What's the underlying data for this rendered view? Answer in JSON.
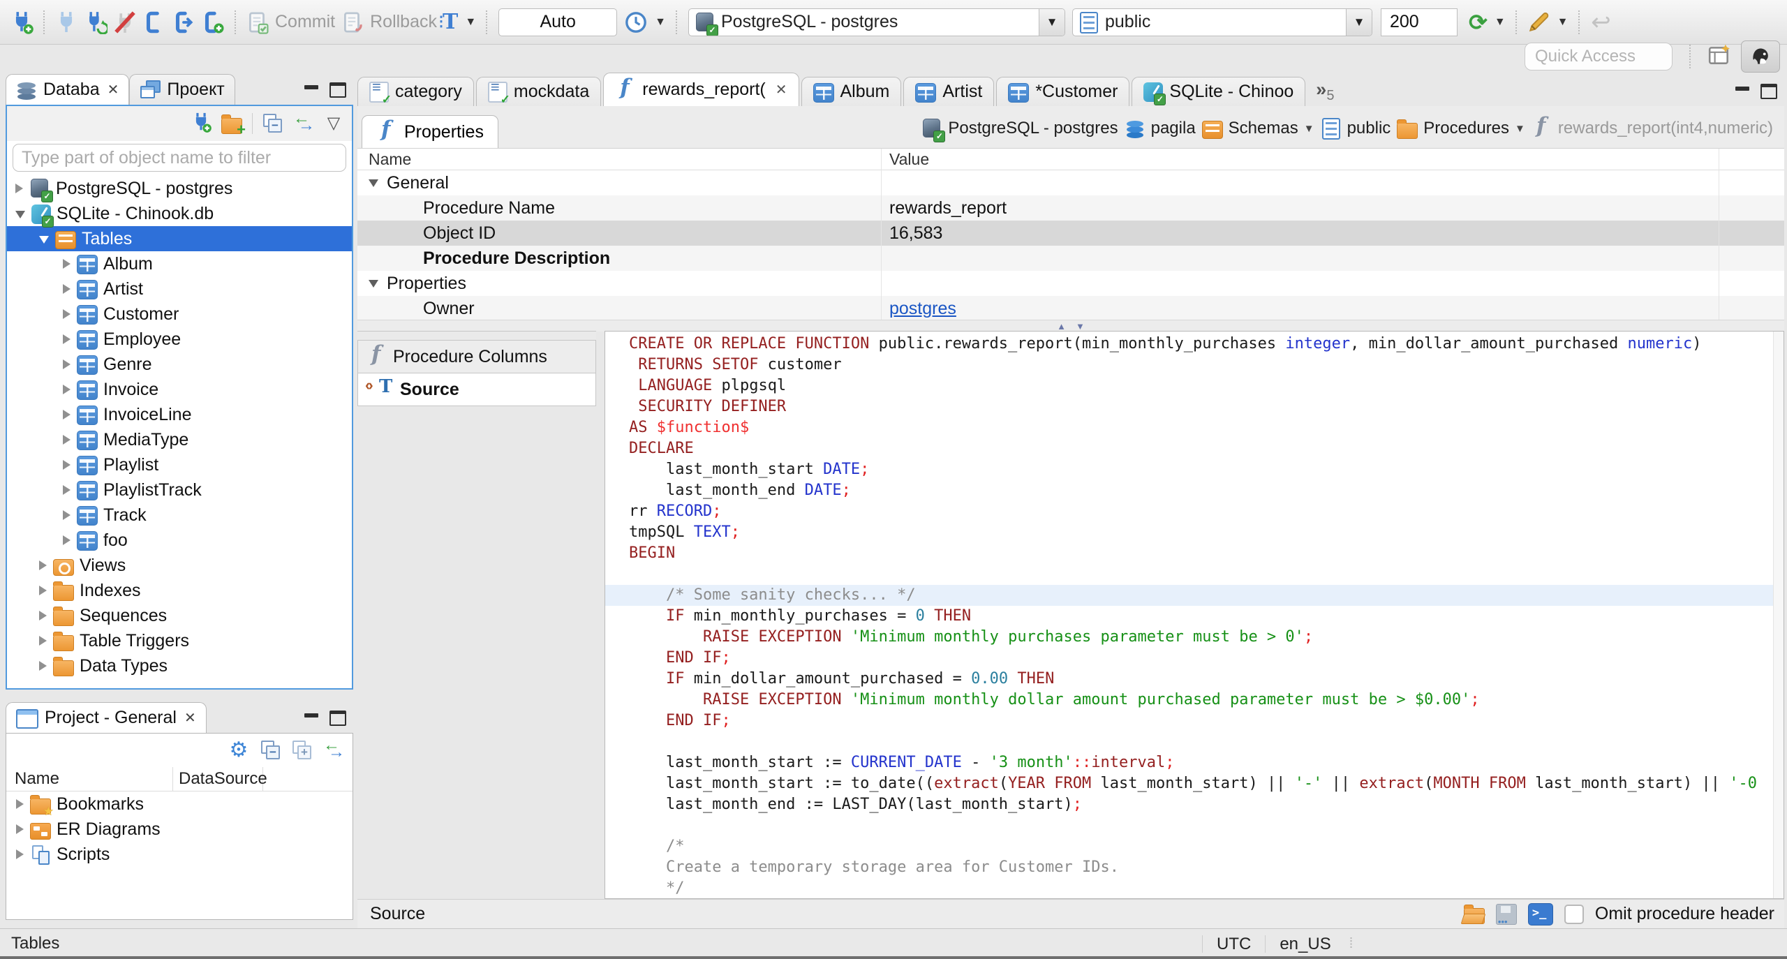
{
  "colors": {
    "selection_blue": "#2e70d9",
    "focus_border_blue": "#519ade",
    "link_blue": "#1a56c4",
    "syntax_keyword": "#941f1f",
    "syntax_type": "#2333cc",
    "syntax_string": "#169016",
    "syntax_number": "#2a7f9e",
    "syntax_punct": "#e02020",
    "syntax_comment": "#8c8c8c",
    "current_line": "#e7f0fb",
    "folder_orange": "#ec9733",
    "table_blue": "#4384cc"
  },
  "toolbar": {
    "commit": "Commit",
    "rollback": "Rollback",
    "auto_commit": "Auto",
    "connection": "PostgreSQL - postgres",
    "schema": "public",
    "fetch_size": "200",
    "quick_access_placeholder": "Quick Access"
  },
  "nav": {
    "tab_database": "Databa",
    "tab_project": "Проект",
    "filter_placeholder": "Type part of object name to filter",
    "tree": [
      {
        "ind": 0,
        "exp": "c",
        "icon": "pg",
        "label": "PostgreSQL - postgres"
      },
      {
        "ind": 0,
        "exp": "o",
        "icon": "sqlite",
        "label": "SQLite - Chinook.db"
      },
      {
        "ind": 1,
        "exp": "o",
        "icon": "tables",
        "label": "Tables",
        "sel": true
      },
      {
        "ind": 2,
        "exp": "c",
        "icon": "table",
        "label": "Album"
      },
      {
        "ind": 2,
        "exp": "c",
        "icon": "table",
        "label": "Artist"
      },
      {
        "ind": 2,
        "exp": "c",
        "icon": "table",
        "label": "Customer"
      },
      {
        "ind": 2,
        "exp": "c",
        "icon": "table",
        "label": "Employee"
      },
      {
        "ind": 2,
        "exp": "c",
        "icon": "table",
        "label": "Genre"
      },
      {
        "ind": 2,
        "exp": "c",
        "icon": "table",
        "label": "Invoice"
      },
      {
        "ind": 2,
        "exp": "c",
        "icon": "table",
        "label": "InvoiceLine"
      },
      {
        "ind": 2,
        "exp": "c",
        "icon": "table",
        "label": "MediaType"
      },
      {
        "ind": 2,
        "exp": "c",
        "icon": "table",
        "label": "Playlist"
      },
      {
        "ind": 2,
        "exp": "c",
        "icon": "table",
        "label": "PlaylistTrack"
      },
      {
        "ind": 2,
        "exp": "c",
        "icon": "table",
        "label": "Track"
      },
      {
        "ind": 2,
        "exp": "c",
        "icon": "table",
        "label": "foo"
      },
      {
        "ind": 1,
        "exp": "c",
        "icon": "views",
        "label": "Views"
      },
      {
        "ind": 1,
        "exp": "c",
        "icon": "folder",
        "label": "Indexes"
      },
      {
        "ind": 1,
        "exp": "c",
        "icon": "folder",
        "label": "Sequences"
      },
      {
        "ind": 1,
        "exp": "c",
        "icon": "folder",
        "label": "Table Triggers"
      },
      {
        "ind": 1,
        "exp": "c",
        "icon": "folder",
        "label": "Data Types"
      }
    ]
  },
  "project": {
    "tab": "Project - General",
    "col_name": "Name",
    "col_datasource": "DataSource",
    "tree": [
      {
        "icon": "bookmarks",
        "label": "Bookmarks"
      },
      {
        "icon": "er",
        "label": "ER Diagrams"
      },
      {
        "icon": "scripts",
        "label": "Scripts"
      }
    ]
  },
  "editor": {
    "tabs": [
      {
        "icon": "sql",
        "label": "category"
      },
      {
        "icon": "sql",
        "label": "mockdata"
      },
      {
        "icon": "func",
        "label": "rewards_report(",
        "active": true,
        "close": true
      },
      {
        "icon": "table",
        "label": "Album"
      },
      {
        "icon": "table",
        "label": "Artist"
      },
      {
        "icon": "table",
        "label": "*Customer"
      },
      {
        "icon": "sqlite",
        "label": "SQLite - Chinoo"
      }
    ],
    "overflow_count": "5"
  },
  "properties_view": {
    "tab": "Properties",
    "breadcrumb": [
      {
        "icon": "pg",
        "label": "PostgreSQL - postgres"
      },
      {
        "icon": "dbblue",
        "label": "pagila"
      },
      {
        "icon": "tables",
        "label": "Schemas",
        "dd": true
      },
      {
        "icon": "schema",
        "label": "public"
      },
      {
        "icon": "folder",
        "label": "Procedures",
        "dd": true
      },
      {
        "icon": "func",
        "label": "rewards_report(int4,numeric)",
        "muted": true
      }
    ],
    "grid": {
      "col_name": "Name",
      "col_value": "Value",
      "rows": [
        {
          "kind": "category",
          "name": "General"
        },
        {
          "kind": "item",
          "name": "Procedure Name",
          "value": "rewards_report",
          "shade": true
        },
        {
          "kind": "item",
          "name": "Object ID",
          "value": "16,583",
          "selected": true
        },
        {
          "kind": "item",
          "name": "Procedure Description",
          "value": "",
          "bold": true,
          "shade": true
        },
        {
          "kind": "category",
          "name": "Properties"
        },
        {
          "kind": "item",
          "name": "Owner",
          "value": "postgres",
          "link": true,
          "shade": true
        }
      ]
    }
  },
  "subtabs": [
    {
      "label": "Procedure Columns",
      "icon": "func"
    },
    {
      "label": "Source",
      "icon": "source",
      "active": true
    }
  ],
  "source_editor": {
    "lines": [
      {
        "t": [
          [
            "k",
            "CREATE OR REPLACE FUNCTION"
          ],
          [
            "d",
            " public.rewards_report(min_monthly_purchases "
          ],
          [
            "t",
            "integer"
          ],
          [
            "d",
            ", min_dollar_amount_purchased "
          ],
          [
            "t",
            "numeric"
          ],
          [
            "d",
            ")"
          ]
        ]
      },
      {
        "t": [
          [
            "d",
            " "
          ],
          [
            "k",
            "RETURNS SETOF"
          ],
          [
            "d",
            " customer"
          ]
        ]
      },
      {
        "t": [
          [
            "d",
            " "
          ],
          [
            "k",
            "LANGUAGE"
          ],
          [
            "d",
            " plpgsql"
          ]
        ]
      },
      {
        "t": [
          [
            "d",
            " "
          ],
          [
            "k",
            "SECURITY DEFINER"
          ]
        ]
      },
      {
        "t": [
          [
            "k",
            "AS"
          ],
          [
            "d",
            " "
          ],
          [
            "r",
            "$function$"
          ]
        ]
      },
      {
        "t": [
          [
            "k",
            "DECLARE"
          ]
        ]
      },
      {
        "t": [
          [
            "d",
            "    last_month_start "
          ],
          [
            "t",
            "DATE"
          ],
          [
            "p",
            ";"
          ]
        ]
      },
      {
        "t": [
          [
            "d",
            "    last_month_end "
          ],
          [
            "t",
            "DATE"
          ],
          [
            "p",
            ";"
          ]
        ]
      },
      {
        "t": [
          [
            "d",
            "rr "
          ],
          [
            "t",
            "RECORD"
          ],
          [
            "p",
            ";"
          ]
        ]
      },
      {
        "t": [
          [
            "d",
            "tmpSQL "
          ],
          [
            "t",
            "TEXT"
          ],
          [
            "p",
            ";"
          ]
        ]
      },
      {
        "t": [
          [
            "k",
            "BEGIN"
          ]
        ]
      },
      {
        "t": []
      },
      {
        "hl": true,
        "t": [
          [
            "c",
            "    /* Some sanity checks... */"
          ]
        ]
      },
      {
        "t": [
          [
            "d",
            "    "
          ],
          [
            "k",
            "IF"
          ],
          [
            "d",
            " min_monthly_purchases = "
          ],
          [
            "n",
            "0"
          ],
          [
            "d",
            " "
          ],
          [
            "k",
            "THEN"
          ]
        ]
      },
      {
        "t": [
          [
            "d",
            "        "
          ],
          [
            "k",
            "RAISE EXCEPTION"
          ],
          [
            "d",
            " "
          ],
          [
            "s",
            "'Minimum monthly purchases parameter must be > 0'"
          ],
          [
            "p",
            ";"
          ]
        ]
      },
      {
        "t": [
          [
            "d",
            "    "
          ],
          [
            "k",
            "END IF"
          ],
          [
            "p",
            ";"
          ]
        ]
      },
      {
        "t": [
          [
            "d",
            "    "
          ],
          [
            "k",
            "IF"
          ],
          [
            "d",
            " min_dollar_amount_purchased = "
          ],
          [
            "n",
            "0.00"
          ],
          [
            "d",
            " "
          ],
          [
            "k",
            "THEN"
          ]
        ]
      },
      {
        "t": [
          [
            "d",
            "        "
          ],
          [
            "k",
            "RAISE EXCEPTION"
          ],
          [
            "d",
            " "
          ],
          [
            "s",
            "'Minimum monthly dollar amount purchased parameter must be > $0.00'"
          ],
          [
            "p",
            ";"
          ]
        ]
      },
      {
        "t": [
          [
            "d",
            "    "
          ],
          [
            "k",
            "END IF"
          ],
          [
            "p",
            ";"
          ]
        ]
      },
      {
        "t": []
      },
      {
        "t": [
          [
            "d",
            "    last_month_start := "
          ],
          [
            "t",
            "CURRENT_DATE"
          ],
          [
            "d",
            " - "
          ],
          [
            "s",
            "'3 month'"
          ],
          [
            "p",
            "::"
          ],
          [
            "k",
            "interval"
          ],
          [
            "p",
            ";"
          ]
        ]
      },
      {
        "t": [
          [
            "d",
            "    last_month_start := to_date(("
          ],
          [
            "k",
            "extract"
          ],
          [
            "d",
            "("
          ],
          [
            "k",
            "YEAR FROM"
          ],
          [
            "d",
            " last_month_start) || "
          ],
          [
            "s",
            "'-'"
          ],
          [
            "d",
            " || "
          ],
          [
            "k",
            "extract"
          ],
          [
            "d",
            "("
          ],
          [
            "k",
            "MONTH FROM"
          ],
          [
            "d",
            " last_month_start) || "
          ],
          [
            "s",
            "'-0"
          ]
        ]
      },
      {
        "t": [
          [
            "d",
            "    last_month_end := LAST_DAY(last_month_start)"
          ],
          [
            "p",
            ";"
          ]
        ]
      },
      {
        "t": []
      },
      {
        "t": [
          [
            "c",
            "    /*"
          ]
        ]
      },
      {
        "t": [
          [
            "c",
            "    Create a temporary storage area for Customer IDs."
          ]
        ]
      },
      {
        "t": [
          [
            "c",
            "    */"
          ]
        ]
      }
    ]
  },
  "bottom_bar": {
    "label": "Source",
    "omit_checkbox_label": "Omit procedure header"
  },
  "status_bar": {
    "left": "Tables",
    "timezone": "UTC",
    "locale": "en_US"
  }
}
